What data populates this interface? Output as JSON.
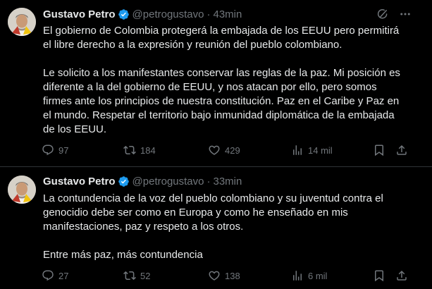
{
  "tweets": [
    {
      "author": {
        "name": "Gustavo Petro",
        "handle": "@petrogustavo",
        "verified": true
      },
      "separator": "·",
      "time": "43min",
      "text": "El gobierno de Colombia protegerá la embajada de los EEUU pero permitirá\nel libre derecho a la expresión y reunión del pueblo colombiano.\n\nLe solicito a los manifestantes conservar las reglas de la paz. Mi posición es\ndiferente a la del gobierno de EEUU, y nos atacan por ello, pero somos\nfirmes ante los principios de nuestra constitución. Paz en el Caribe y Paz en\nel mundo. Respetar el territorio bajo inmunidad diplomática de la embajada\nde los EEUU.",
      "stats": {
        "replies": "97",
        "retweets": "184",
        "likes": "429",
        "views": "14 mil"
      }
    },
    {
      "author": {
        "name": "Gustavo Petro",
        "handle": "@petrogustavo",
        "verified": true
      },
      "separator": "·",
      "time": "33min",
      "text": "La contundencia de la voz del pueblo colombiano y su juventud contra el\ngenocidio debe ser como en Europa y como he enseñado en mis\nmanifestaciones, paz y respeto a los otros.\n\nEntre más paz, más contundencia",
      "stats": {
        "replies": "27",
        "retweets": "52",
        "likes": "138",
        "views": "6 mil"
      }
    }
  ],
  "icons": {
    "verified": "verified-badge-icon",
    "grok": "grok-icon",
    "more": "more-icon",
    "reply": "reply-icon",
    "retweet": "retweet-icon",
    "like": "heart-icon",
    "views": "views-icon",
    "bookmark": "bookmark-icon",
    "share": "share-icon"
  },
  "colors": {
    "background": "#000000",
    "text": "#e7e9ea",
    "secondary": "#71767b",
    "verified": "#1d9bf0",
    "divider": "#2f3336"
  }
}
